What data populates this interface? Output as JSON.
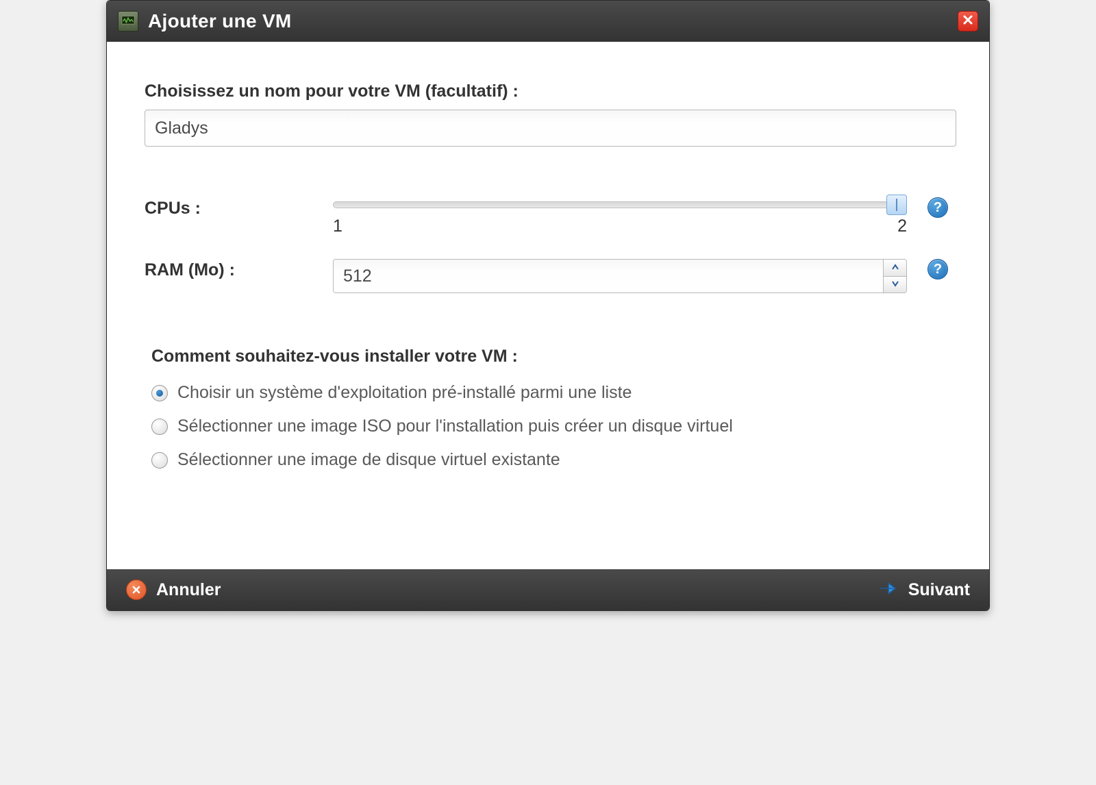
{
  "dialog": {
    "title": "Ajouter une VM"
  },
  "vm_name": {
    "label": "Choisissez un nom pour votre VM (facultatif) :",
    "value": "Gladys"
  },
  "cpu": {
    "label": "CPUs :",
    "min": "1",
    "max": "2",
    "value": 2
  },
  "ram": {
    "label": "RAM (Mo) :",
    "value": "512"
  },
  "install": {
    "heading": "Comment souhaitez-vous installer votre VM :",
    "options": [
      "Choisir un système d'exploitation pré-installé parmi une liste",
      "Sélectionner une image ISO pour l'installation puis créer un disque virtuel",
      "Sélectionner une image de disque virtuel existante"
    ],
    "selected_index": 0
  },
  "footer": {
    "cancel": "Annuler",
    "next": "Suivant"
  }
}
